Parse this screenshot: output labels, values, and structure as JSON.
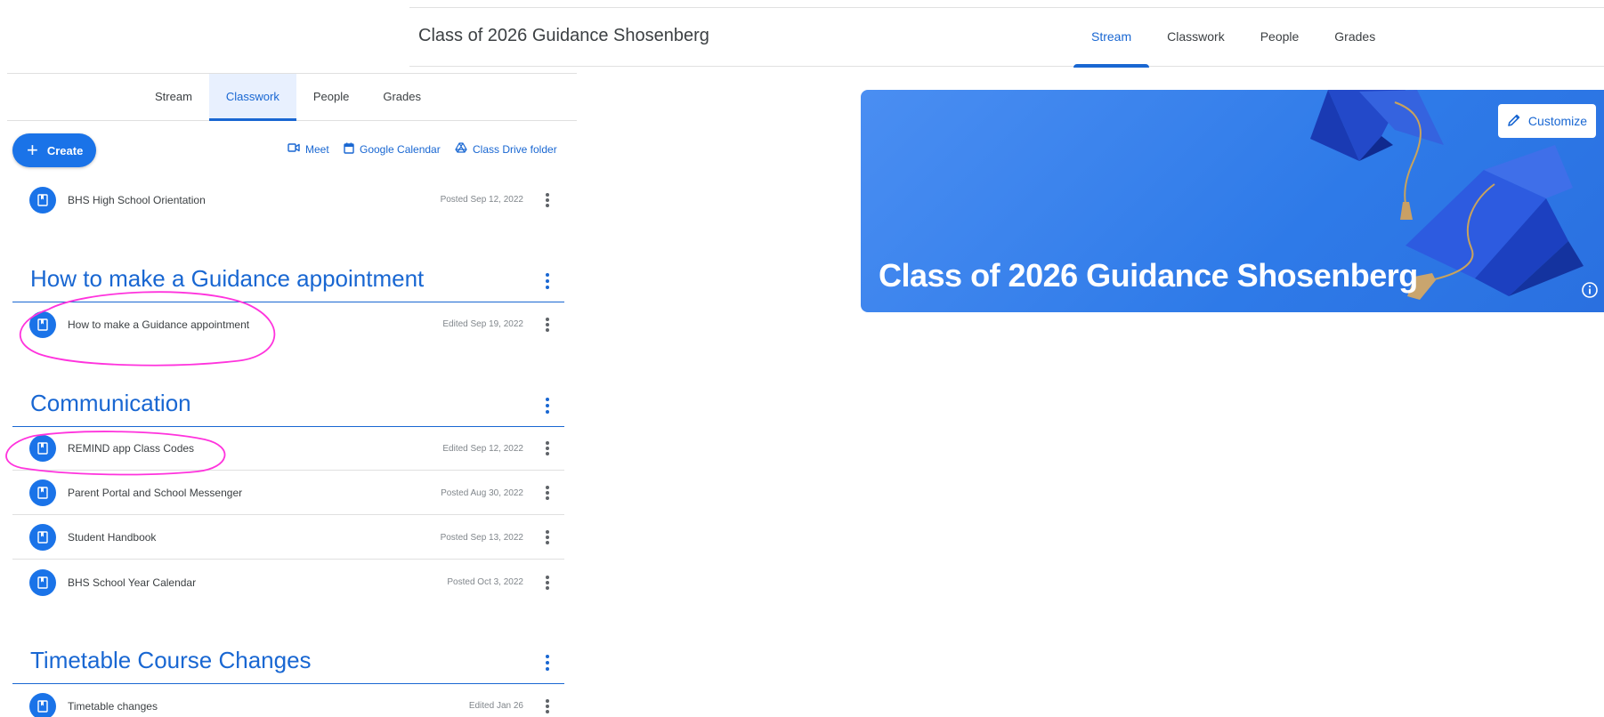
{
  "stream_window": {
    "class_title": "Class of 2026 Guidance Shosenberg",
    "tabs": [
      "Stream",
      "Classwork",
      "People",
      "Grades"
    ],
    "active_tab": "Stream",
    "banner": {
      "title": "Class of 2026 Guidance Shosenberg",
      "customize_label": "Customize"
    }
  },
  "classwork_window": {
    "tabs": [
      "Stream",
      "Classwork",
      "People",
      "Grades"
    ],
    "active_tab": "Classwork",
    "create_label": "Create",
    "links": {
      "meet": "Meet",
      "calendar": "Google Calendar",
      "drive": "Class Drive folder"
    },
    "ungrouped_items": [
      {
        "title": "BHS High School Orientation",
        "date": "Posted Sep 12, 2022"
      }
    ],
    "topics": [
      {
        "title": "How to make a Guidance appointment",
        "items": [
          {
            "title": "How to make a Guidance appointment",
            "date": "Edited Sep 19, 2022"
          }
        ]
      },
      {
        "title": "Communication",
        "items": [
          {
            "title": "REMIND app Class Codes",
            "date": "Edited Sep 12, 2022"
          },
          {
            "title": "Parent Portal and School Messenger",
            "date": "Posted Aug 30, 2022"
          },
          {
            "title": "Student Handbook",
            "date": "Posted Sep 13, 2022"
          },
          {
            "title": "BHS School Year Calendar",
            "date": "Posted Oct 3, 2022"
          }
        ]
      },
      {
        "title": "Timetable Course Changes",
        "items": [
          {
            "title": "Timetable changes",
            "date": "Edited Jan 26"
          }
        ]
      }
    ]
  },
  "colors": {
    "accent_blue": "#1967d2",
    "button_blue": "#1a73e8",
    "banner_blue": "#3b82ee",
    "annotation_magenta": "#ff33dd"
  },
  "icons": {
    "material": "material-icon",
    "overflow": "more-vert-icon",
    "meet": "video-camera-icon",
    "calendar": "calendar-icon",
    "drive": "google-drive-icon",
    "customize": "pencil-icon",
    "info": "info-icon"
  }
}
